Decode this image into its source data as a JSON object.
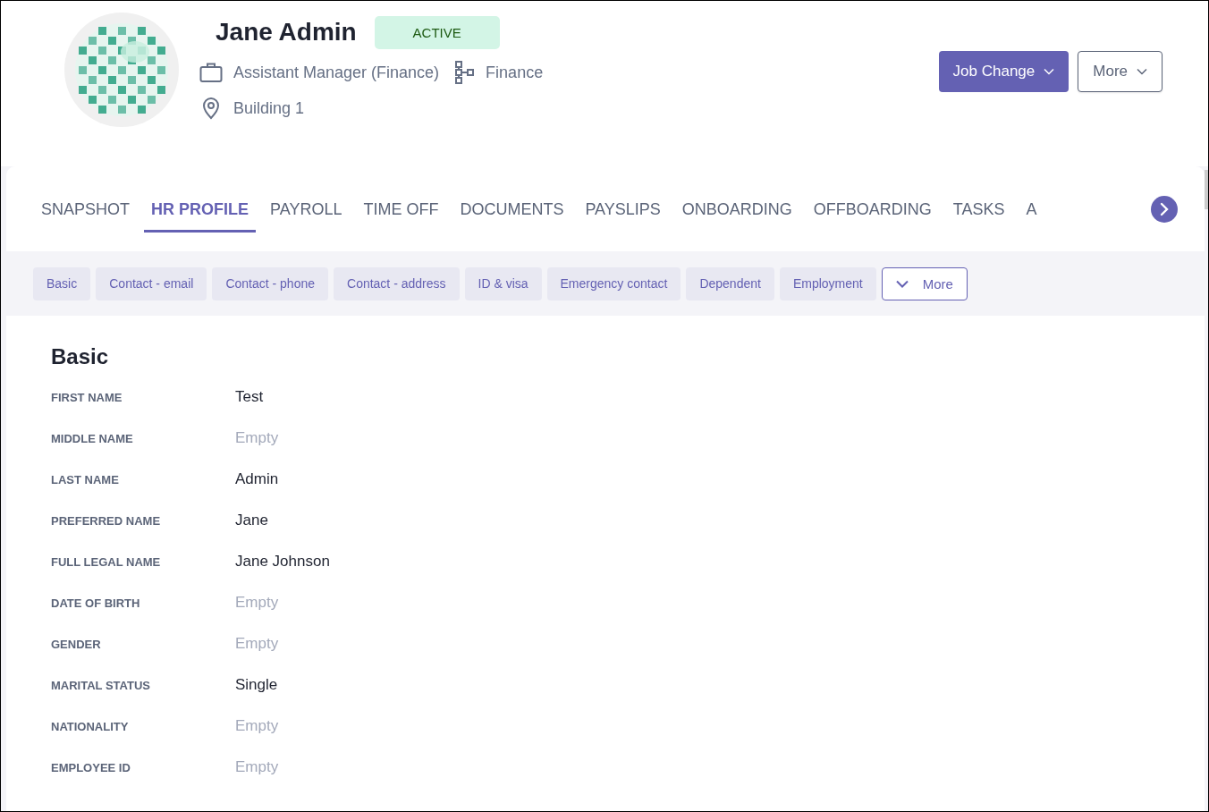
{
  "profile": {
    "name": "Jane Admin",
    "status": "ACTIVE",
    "job_title": "Assistant Manager (Finance)",
    "department": "Finance",
    "location": "Building 1"
  },
  "actions": [
    {
      "label": "Job Change",
      "kind": "primary"
    },
    {
      "label": "More",
      "kind": "secondary"
    }
  ],
  "tabs": [
    {
      "label": "SNAPSHOT",
      "selected": false
    },
    {
      "label": "HR PROFILE",
      "selected": true
    },
    {
      "label": "PAYROLL",
      "selected": false
    },
    {
      "label": "TIME OFF",
      "selected": false
    },
    {
      "label": "DOCUMENTS",
      "selected": false
    },
    {
      "label": "PAYSLIPS",
      "selected": false
    },
    {
      "label": "ONBOARDING",
      "selected": false
    },
    {
      "label": "OFFBOARDING",
      "selected": false
    },
    {
      "label": "TASKS",
      "selected": false
    },
    {
      "label": "A",
      "selected": false
    }
  ],
  "sections": [
    "Basic",
    "Contact - email",
    "Contact - phone",
    "Contact - address",
    "ID & visa",
    "Emergency contact",
    "Dependent",
    "Employment"
  ],
  "sections_more": "More",
  "section_title": "Basic",
  "fields": [
    {
      "label": "FIRST NAME",
      "value": "Test",
      "empty": false
    },
    {
      "label": "MIDDLE NAME",
      "value": "Empty",
      "empty": true
    },
    {
      "label": "LAST NAME",
      "value": "Admin",
      "empty": false
    },
    {
      "label": "PREFERRED NAME",
      "value": "Jane",
      "empty": false
    },
    {
      "label": "FULL LEGAL NAME",
      "value": "Jane Johnson",
      "empty": false
    },
    {
      "label": "DATE OF BIRTH",
      "value": "Empty",
      "empty": true
    },
    {
      "label": "GENDER",
      "value": "Empty",
      "empty": true
    },
    {
      "label": "MARITAL STATUS",
      "value": "Single",
      "empty": false
    },
    {
      "label": "NATIONALITY",
      "value": "Empty",
      "empty": true
    },
    {
      "label": "EMPLOYEE ID",
      "value": "Empty",
      "empty": true
    }
  ]
}
